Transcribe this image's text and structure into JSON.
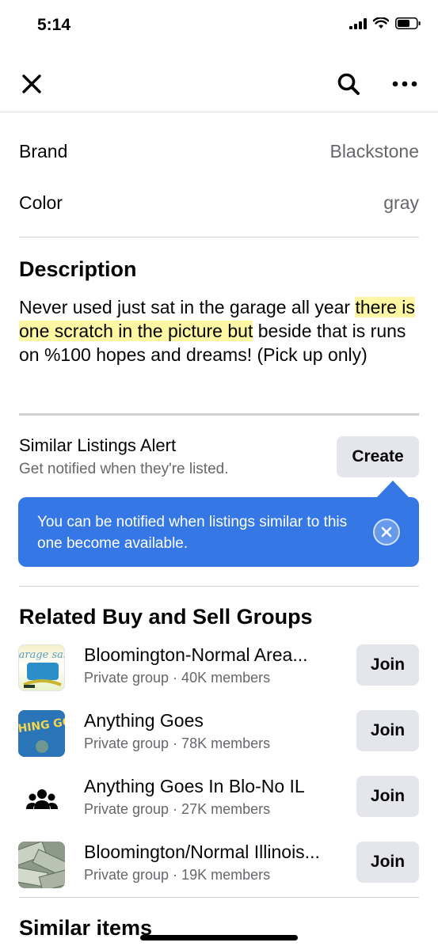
{
  "status_bar": {
    "time": "5:14"
  },
  "details": [
    {
      "label": "Brand",
      "value": "Blackstone"
    },
    {
      "label": "Color",
      "value": "gray"
    }
  ],
  "description": {
    "title": "Description",
    "part1": "Never used just sat in the garage all year ",
    "part2": "there is one scratch in the picture but",
    "part3": " beside that is runs on %100 hopes and dreams! (Pick up only)"
  },
  "alert": {
    "title": "Similar Listings Alert",
    "subtitle": "Get notified when they're listed.",
    "create_label": "Create",
    "tooltip": "You can be notified when listings similar to this one become available."
  },
  "groups_section": {
    "title": "Related Buy and Sell Groups",
    "join_label": "Join",
    "items": [
      {
        "name": "Bloomington-Normal Area...",
        "meta": "Private group · 40K members",
        "thumb_icon": "garage-sale-thumbnail",
        "thumb_text": "garage sale"
      },
      {
        "name": "Anything Goes",
        "meta": "Private group · 78K members",
        "thumb_icon": "anything-goes-thumbnail",
        "thumb_text": "THING GO"
      },
      {
        "name": "Anything Goes In Blo-No IL",
        "meta": "Private group · 27K members",
        "thumb_icon": "group-people-icon"
      },
      {
        "name": "Bloomington/Normal Illinois...",
        "meta": "Private group · 19K members",
        "thumb_icon": "money-thumbnail"
      }
    ]
  },
  "similar_items": {
    "title": "Similar items"
  },
  "colors": {
    "accent": "#3578e5",
    "button_bg": "#e4e6eb",
    "secondary_text": "#65676b",
    "highlight": "#fdf6a3"
  }
}
